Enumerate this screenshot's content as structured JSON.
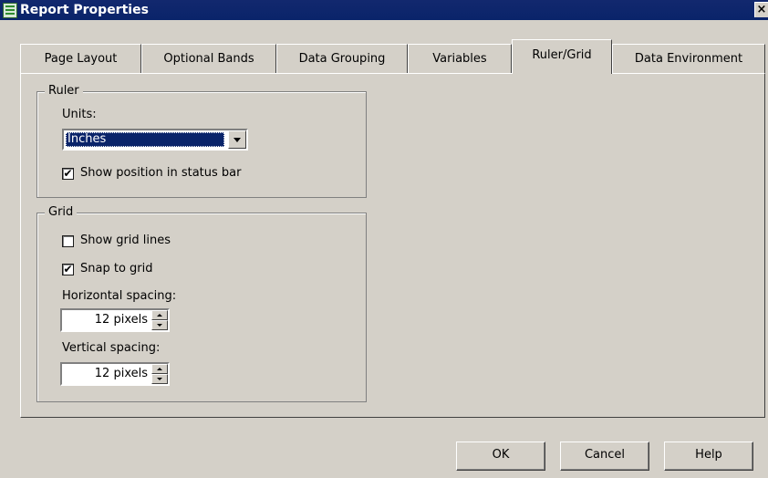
{
  "window": {
    "title": "Report Properties",
    "close_glyph": "×",
    "icon": "report-app-icon"
  },
  "tabs": [
    {
      "label": "Page Layout"
    },
    {
      "label": "Optional Bands"
    },
    {
      "label": "Data Grouping"
    },
    {
      "label": "Variables"
    },
    {
      "label": "Ruler/Grid",
      "active": true
    },
    {
      "label": "Data Environment"
    }
  ],
  "ruler": {
    "group_label": "Ruler",
    "units_label": "Units:",
    "units_value": "Inches",
    "show_position_label": "Show position in status bar",
    "show_position_checked": true
  },
  "grid": {
    "group_label": "Grid",
    "show_grid_lines_label": "Show grid lines",
    "show_grid_lines_checked": false,
    "snap_to_grid_label": "Snap to grid",
    "snap_to_grid_checked": true,
    "horizontal_label": "Horizontal spacing:",
    "horizontal_value": "12 pixels",
    "vertical_label": "Vertical spacing:",
    "vertical_value": "12 pixels"
  },
  "buttons": {
    "ok": "OK",
    "cancel": "Cancel",
    "help": "Help"
  },
  "check_glyph": "✔",
  "colors": {
    "title_bar": "#0a246a",
    "dialog_bg": "#d4d0c8",
    "selection": "#0a246a"
  }
}
